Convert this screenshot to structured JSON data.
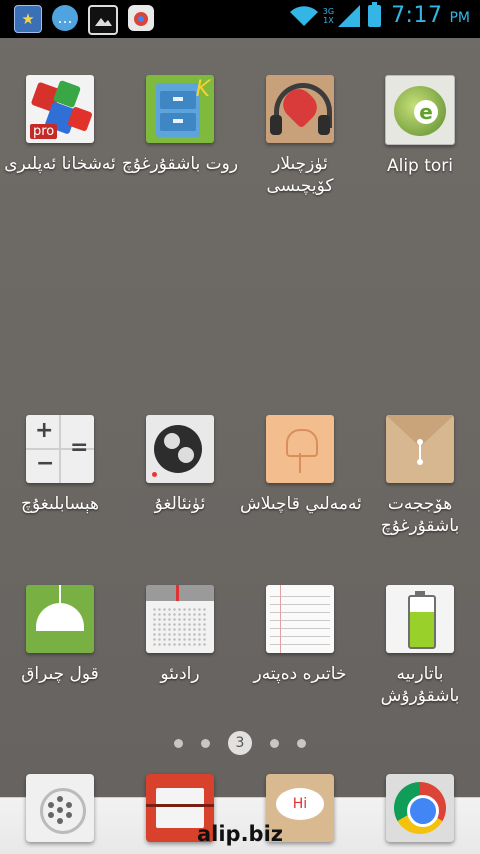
{
  "status_bar": {
    "time": "7:17",
    "ampm": "PM",
    "network": "3G",
    "network2": "1X",
    "notifications": [
      "star-notification-icon",
      "chat-notification-icon",
      "image-notification-icon",
      "store-notification-icon"
    ]
  },
  "apps": [
    {
      "label": "ئەشخانا ئەپلىرى",
      "icon": "office-suite-pro-icon"
    },
    {
      "label": "روت باشقۇرغۇچ",
      "icon": "root-explorer-icon"
    },
    {
      "label": "ئۈزچىلار كۆيچىسى",
      "icon": "music-player-icon"
    },
    {
      "label": "Alip tori",
      "icon": "alip-tori-icon"
    },
    {
      "label": "ھېسابلىغۇچ",
      "icon": "calculator-icon"
    },
    {
      "label": "ئۈنئالغۇ",
      "icon": "sound-recorder-icon"
    },
    {
      "label": "ئەمەلىي قاچىلاش",
      "icon": "tile-installer-icon"
    },
    {
      "label": "ھۆججەت باشقۇرغۇچ",
      "icon": "file-manager-icon"
    },
    {
      "label": "قول چىراق",
      "icon": "flashlight-icon"
    },
    {
      "label": "رادىئو",
      "icon": "radio-icon"
    },
    {
      "label": "خاتىرە دەپتەر",
      "icon": "notepad-icon"
    },
    {
      "label": "باتارىيە باشقۇرۇش",
      "icon": "battery-manager-icon"
    }
  ],
  "pager": {
    "current": "3"
  },
  "dock": [
    "app-drawer-icon",
    "contacts-icon",
    "messaging-icon",
    "chrome-icon"
  ],
  "watermark": "alip.biz"
}
